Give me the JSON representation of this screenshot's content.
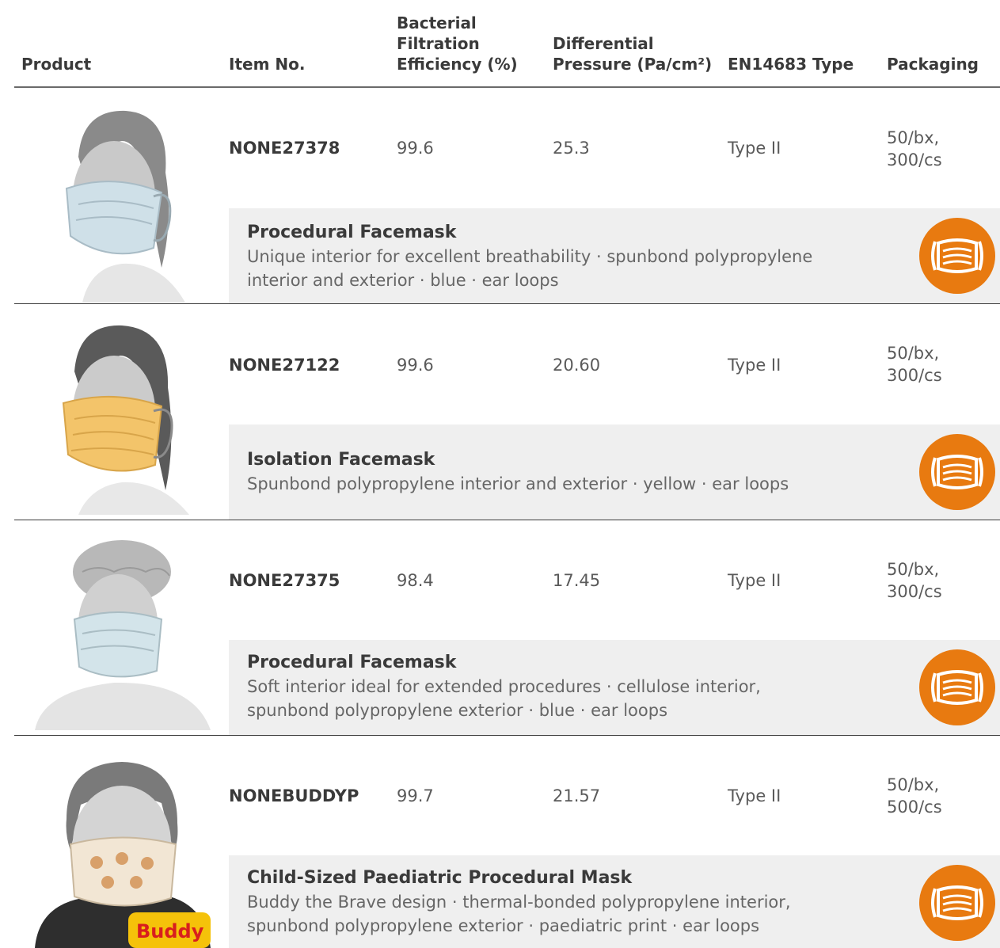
{
  "header": {
    "product": "Product",
    "item_no": "Item No.",
    "bfe_l1": "Bacterial",
    "bfe_l2": "Filtration",
    "bfe_l3": "Efficiency (%)",
    "dp_l1": "Differential",
    "dp_l2": "Pressure (Pa/cm²)",
    "type": "EN14683 Type",
    "packaging": "Packaging"
  },
  "colors": {
    "accent": "#e87a10",
    "panel": "#efefef",
    "rule": "#3a3a3a"
  },
  "icons": {
    "mask": "facemask-icon"
  },
  "products": [
    {
      "item_no": "NONE27378",
      "bfe": "99.6",
      "pressure": "25.3",
      "type": "Type II",
      "pack_l1": "50/bx,",
      "pack_l2": "300/cs",
      "title": "Procedural Facemask",
      "desc_l1": "Unique interior for excellent breathability · spunbond polypropylene",
      "desc_l2": "interior and exterior · blue · ear loops",
      "mask_color": "#cfe0e8"
    },
    {
      "item_no": "NONE27122",
      "bfe": "99.6",
      "pressure": "20.60",
      "type": "Type II",
      "pack_l1": "50/bx,",
      "pack_l2": "300/cs",
      "title": "Isolation Facemask",
      "desc_l1": "Spunbond polypropylene interior and exterior · yellow · ear loops",
      "desc_l2": "",
      "mask_color": "#f3c46a"
    },
    {
      "item_no": "NONE27375",
      "bfe": "98.4",
      "pressure": "17.45",
      "type": "Type II",
      "pack_l1": "50/bx,",
      "pack_l2": "300/cs",
      "title": "Procedural Facemask",
      "desc_l1": "Soft interior ideal for extended procedures · cellulose interior,",
      "desc_l2": "spunbond polypropylene exterior · blue · ear loops",
      "mask_color": "#d3e4ea"
    },
    {
      "item_no": "NONEBUDDYP",
      "bfe": "99.7",
      "pressure": "21.57",
      "type": "Type II",
      "pack_l1": "50/bx,",
      "pack_l2": "500/cs",
      "title": "Child-Sized Paediatric Procedural Mask",
      "desc_l1": "Buddy the Brave design · thermal-bonded polypropylene interior,",
      "desc_l2": "spunbond polypropylene exterior · paediatric print · ear loops",
      "mask_color": "#f2e6d4",
      "logo": "Buddy"
    }
  ]
}
